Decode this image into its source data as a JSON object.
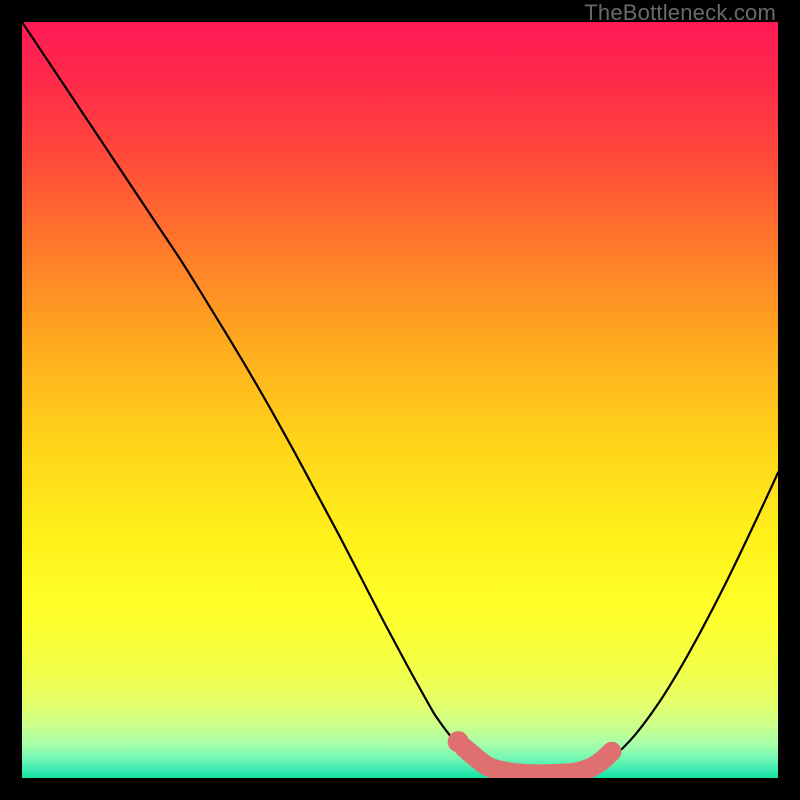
{
  "watermark": "TheBottleneck.com",
  "colors": {
    "background": "#000000",
    "gradient_stops": [
      {
        "offset": 0.0,
        "color": "#ff1a55"
      },
      {
        "offset": 0.08,
        "color": "#ff2a4a"
      },
      {
        "offset": 0.18,
        "color": "#ff4a3a"
      },
      {
        "offset": 0.3,
        "color": "#ff7a2a"
      },
      {
        "offset": 0.42,
        "color": "#ffa81f"
      },
      {
        "offset": 0.55,
        "color": "#ffd21a"
      },
      {
        "offset": 0.68,
        "color": "#fff01a"
      },
      {
        "offset": 0.78,
        "color": "#ffff2a"
      },
      {
        "offset": 0.86,
        "color": "#f2ff4a"
      },
      {
        "offset": 0.9,
        "color": "#e6ff6a"
      },
      {
        "offset": 0.93,
        "color": "#ccff8a"
      },
      {
        "offset": 0.955,
        "color": "#a8ffaa"
      },
      {
        "offset": 0.975,
        "color": "#70f7b4"
      },
      {
        "offset": 0.99,
        "color": "#38eab0"
      },
      {
        "offset": 1.0,
        "color": "#15e2a5"
      }
    ],
    "curve_stroke": "#000000",
    "marker_fill": "#e07070",
    "marker_stroke": "#d86868"
  },
  "chart_data": {
    "type": "line",
    "title": "",
    "xlabel": "",
    "ylabel": "",
    "xlim": [
      0,
      100
    ],
    "ylim": [
      0,
      100
    ],
    "series": [
      {
        "name": "bottleneck-curve",
        "x": [
          0,
          3,
          6,
          9,
          12,
          15,
          18,
          21,
          24,
          27,
          30,
          33,
          36,
          39,
          42,
          45,
          48,
          51,
          54,
          55,
          57,
          60,
          63,
          66,
          69,
          72,
          74,
          76,
          78,
          81,
          84,
          87,
          90,
          93,
          96,
          99,
          100
        ],
        "y": [
          100,
          95.5,
          91,
          86.5,
          82,
          77.5,
          73,
          68.5,
          63.7,
          58.8,
          53.8,
          48.6,
          43.2,
          37.6,
          32.0,
          26.2,
          20.4,
          14.8,
          9.4,
          7.8,
          5.2,
          2.4,
          1.0,
          0.55,
          0.5,
          0.58,
          0.78,
          1.3,
          2.6,
          5.6,
          9.6,
          14.4,
          19.8,
          25.6,
          31.8,
          38.2,
          40.4
        ]
      }
    ],
    "markers": {
      "name": "highlight-segment",
      "points": [
        {
          "x": 58.5,
          "y": 4.0
        },
        {
          "x": 61.5,
          "y": 1.6
        },
        {
          "x": 64.0,
          "y": 0.85
        },
        {
          "x": 66.5,
          "y": 0.55
        },
        {
          "x": 69.0,
          "y": 0.5
        },
        {
          "x": 71.5,
          "y": 0.58
        },
        {
          "x": 73.5,
          "y": 0.8
        },
        {
          "x": 75.2,
          "y": 1.35
        },
        {
          "x": 76.7,
          "y": 2.3
        },
        {
          "x": 78.0,
          "y": 3.5
        }
      ]
    }
  }
}
